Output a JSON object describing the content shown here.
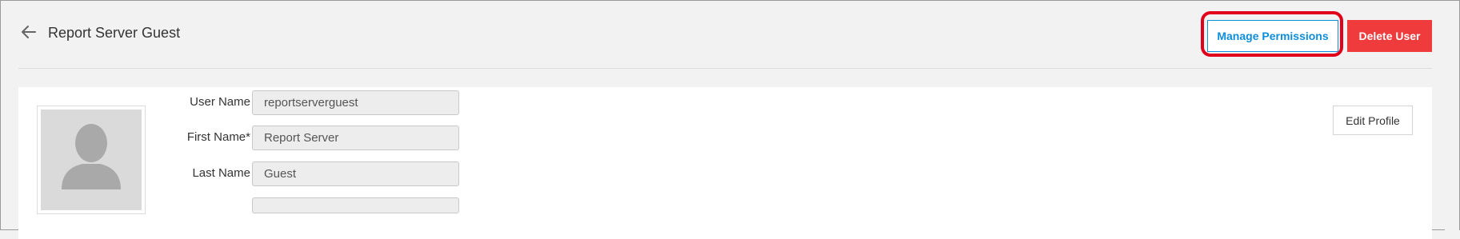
{
  "header": {
    "title": "Report Server Guest",
    "manage_permissions_label": "Manage Permissions",
    "delete_user_label": "Delete User"
  },
  "profile": {
    "edit_profile_label": "Edit Profile",
    "fields": [
      {
        "label": "User Name",
        "value": "reportserverguest"
      },
      {
        "label": "First Name",
        "required_mark": "*",
        "value": "Report Server"
      },
      {
        "label": "Last Name",
        "value": "Guest"
      }
    ]
  },
  "colors": {
    "accent_blue": "#0f8dd9",
    "danger_red": "#ef3b3b",
    "highlight_red": "#e0001b"
  },
  "icons": {
    "back": "arrow-left-icon",
    "avatar": "user-silhouette-icon"
  }
}
